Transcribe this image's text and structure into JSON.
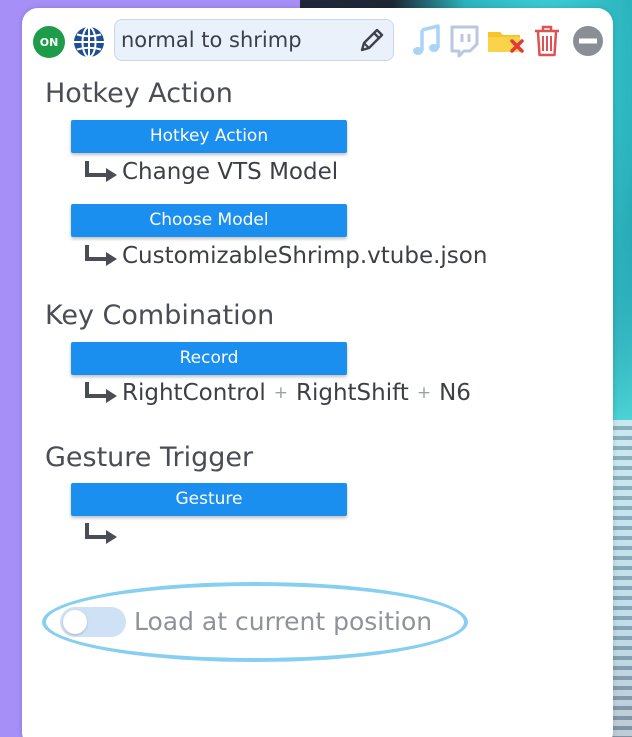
{
  "toolbar": {
    "status_badge": "ON",
    "hotkey_name": "normal to shrimp",
    "icons": [
      "globe-icon",
      "pencil-icon",
      "music-note-icon",
      "twitch-icon",
      "folder-remove-icon",
      "trash-icon",
      "remove-circle-icon"
    ],
    "colors": {
      "status_on": "#1d9c4a",
      "accent": "#1b8ff0",
      "folder": "#f7c42a",
      "delete": "#e05252"
    }
  },
  "hotkey_action": {
    "heading": "Hotkey Action",
    "action_button": "Hotkey Action",
    "action_value": "Change VTS Model",
    "model_button": "Choose Model",
    "model_value": "CustomizableShrimp.vtube.json"
  },
  "key_combination": {
    "heading": "Key Combination",
    "record_button": "Record",
    "keys": [
      "RightControl",
      "RightShift",
      "N6"
    ],
    "separator": "+"
  },
  "gesture_trigger": {
    "heading": "Gesture Trigger",
    "gesture_button": "Gesture",
    "gesture_value": ""
  },
  "options": {
    "load_at_position_label": "Load at current position",
    "load_at_position_enabled": false
  }
}
